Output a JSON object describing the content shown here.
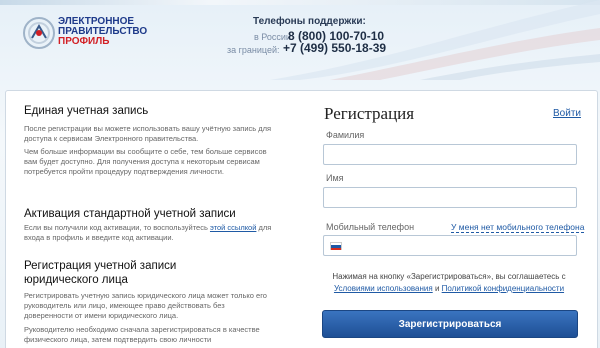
{
  "header": {
    "logo": {
      "line1": "ЭЛЕКТРОННОЕ",
      "line2": "ПРАВИТЕЛЬСТВО",
      "line3": "ПРОФИЛЬ"
    },
    "support": {
      "title": "Телефоны поддержки:",
      "russia_label": "в России:",
      "russia_phone": "8 (800) 100-70-10",
      "abroad_label": "за границей:",
      "abroad_phone": "+7 (499) 550-18-39"
    }
  },
  "left": {
    "s1_title": "Единая учетная запись",
    "s1_p1": "После регистрации вы можете использовать вашу учётную запись для доступа к сервисам Электронного правительства.",
    "s1_p2": "Чем больше информации вы сообщите о себе, тем больше сервисов вам будет доступно. Для получения доступа к некоторым сервисам потребуется пройти процедуру подтверждения личности.",
    "s2_title": "Активация стандартной учетной записи",
    "s2_p_pre": "Если вы получили код активации, то воспользуйтесь ",
    "s2_link": "этой ссылкой",
    "s2_p_post": " для входа в профиль и введите код активации.",
    "s3_title_1": "Регистрация учетной записи",
    "s3_title_2": "юридического лица",
    "s3_p1": "Регистрировать учетную запись юридического лица может только его руководитель или лицо, имеющее право действовать без доверенности от имени юридического лица.",
    "s3_p2": "Руководителю необходимо сначала зарегистрироваться в качестве физического лица, затем подтвердить свою личности"
  },
  "form": {
    "title": "Регистрация",
    "login_link": "Войти",
    "surname_label": "Фамилия",
    "name_label": "Имя",
    "phone_label": "Мобильный телефон",
    "no_phone_link": "У меня нет мобильного телефона",
    "agree_pre": "Нажимая на кнопку «Зарегистрироваться», вы соглашаетесь с ",
    "terms_link": "Условиями использования",
    "agree_mid": " и ",
    "privacy_link": "Политикой конфиденциальности",
    "submit_label": "Зарегистрироваться"
  },
  "colors": {
    "brand_blue": "#1e3a8a",
    "brand_red": "#d21f24",
    "link": "#1f5aa5",
    "button": "#2a62ad"
  }
}
